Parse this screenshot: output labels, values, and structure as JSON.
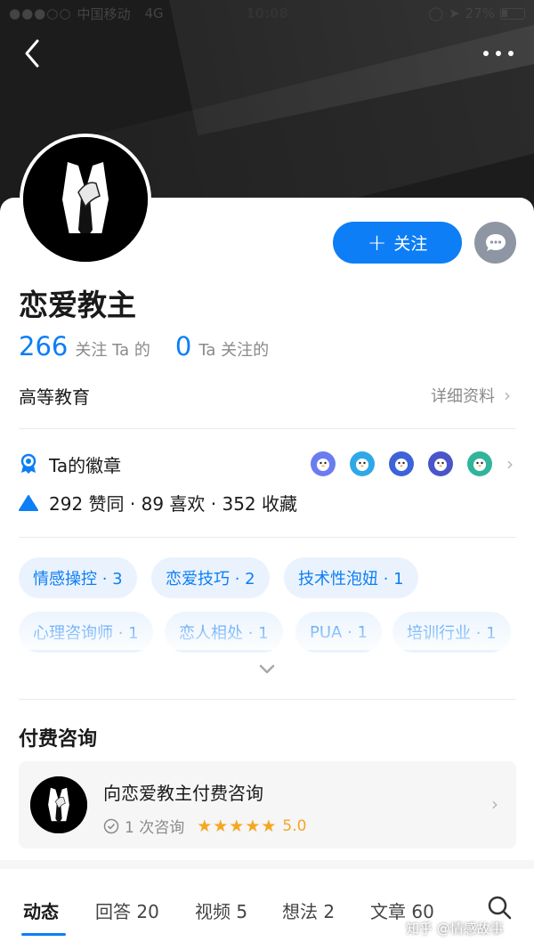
{
  "status_bar": {
    "carrier": "中国移动",
    "network": "4G",
    "time": "10:08",
    "battery": "27%",
    "signal_dots": "●●●○○"
  },
  "header": {
    "back_icon": "chevron-left-icon",
    "more_icon": "more-horizontal-icon"
  },
  "profile": {
    "name": "恋爱教主",
    "follow_label": "关注",
    "following_count": "266",
    "following_label": "关注 Ta 的",
    "followers_count": "0",
    "followers_label": "Ta 关注的",
    "industry": "高等教育",
    "detail_label": "详细资料"
  },
  "badges": {
    "label": "Ta的徽章",
    "icons": [
      "badge-penguin-icon",
      "badge-penguin-icon",
      "badge-penguin-icon",
      "badge-penguin-icon",
      "badge-penguin-icon"
    ]
  },
  "engagement": {
    "text": "292 赞同 · 89 喜欢 · 352 收藏"
  },
  "tags": [
    "情感操控 · 3",
    "恋爱技巧 · 2",
    "技术性泡妞 · 1",
    "心理咨询师 · 1",
    "恋人相处 · 1",
    "PUA · 1",
    "培训行业 · 1"
  ],
  "paid_consult": {
    "section_title": "付费咨询",
    "title": "向恋爱教主付费咨询",
    "count": "1 次咨询",
    "stars": "★★★★★",
    "rating": "5.0"
  },
  "tabs": [
    {
      "label": "动态",
      "active": true
    },
    {
      "label": "回答 20",
      "active": false
    },
    {
      "label": "视频 5",
      "active": false
    },
    {
      "label": "想法 2",
      "active": false
    },
    {
      "label": "文章 60",
      "active": false
    }
  ],
  "watermark": "知乎 @情感故事",
  "colors": {
    "accent": "#0d7ef5",
    "star": "#f5a623",
    "tag_bg": "#eaf3fd"
  }
}
